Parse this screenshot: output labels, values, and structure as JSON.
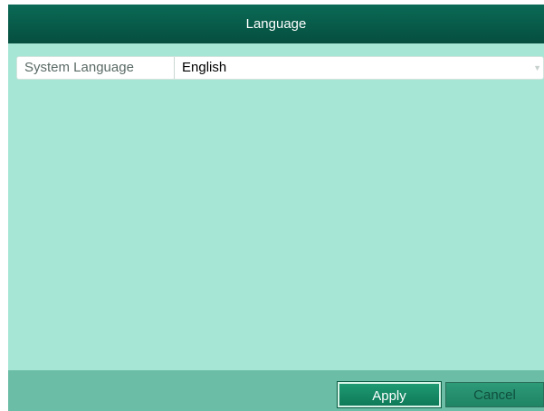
{
  "dialog": {
    "title": "Language"
  },
  "form": {
    "system_language": {
      "label": "System Language",
      "value": "English",
      "dropdown_icon": "chevron-down-icon"
    }
  },
  "footer": {
    "apply_label": "Apply",
    "cancel_label": "Cancel"
  },
  "colors": {
    "title_bar": "#064e3f",
    "body_background": "#a6e6d4",
    "footer_background": "#6bbda5",
    "primary_button": "#0f7a58"
  }
}
